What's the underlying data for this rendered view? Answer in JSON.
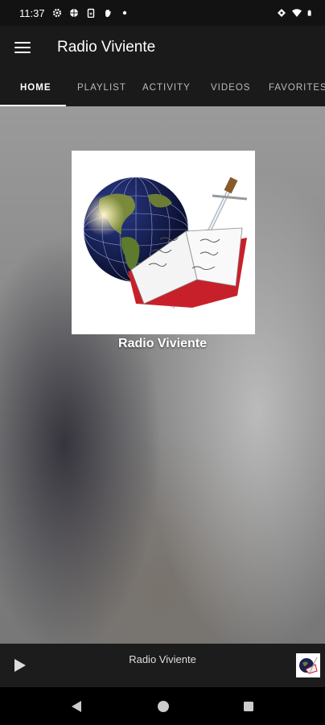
{
  "status_bar": {
    "time": "11:37",
    "left_icons": [
      "gear-icon",
      "network-icon",
      "battery-saver-icon",
      "hand-icon",
      "dot-icon"
    ],
    "right_icons": [
      "vpn-key-icon",
      "wifi-icon",
      "battery-icon"
    ]
  },
  "app_bar": {
    "title": "Radio Viviente",
    "menu_icon": "hamburger-menu-icon"
  },
  "tabs": [
    {
      "label": "HOME",
      "active": true
    },
    {
      "label": "PLAYLIST",
      "active": false
    },
    {
      "label": "ACTIVITY",
      "active": false
    },
    {
      "label": "VIDEOS",
      "active": false
    },
    {
      "label": "FAVORITES",
      "active": false
    }
  ],
  "main": {
    "station_name": "Radio Viviente",
    "artwork_icon": "globe-bible-sword-logo"
  },
  "player": {
    "play_icon": "play-icon",
    "now_playing": "Radio Viviente",
    "thumbnail_icon": "station-thumbnail-icon"
  },
  "nav_bar": {
    "icons": [
      "back-icon",
      "home-icon",
      "recents-icon"
    ]
  }
}
